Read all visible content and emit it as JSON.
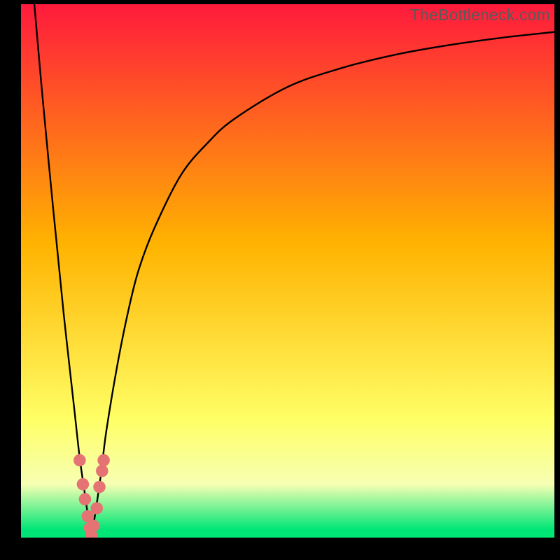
{
  "watermark": "TheBottleneck.com",
  "colors": {
    "gradient_top": "#ff1a3c",
    "gradient_mid": "#ffb300",
    "gradient_low": "#ffff66",
    "gradient_band": "#f6ffb3",
    "gradient_bottom": "#00e676",
    "curve": "#000000",
    "dot": "#e57373",
    "frame": "#000000"
  },
  "chart_data": {
    "type": "line",
    "title": "",
    "xlabel": "",
    "ylabel": "",
    "xlim": [
      0,
      100
    ],
    "ylim": [
      0,
      100
    ],
    "grid": false,
    "series": [
      {
        "name": "bottleneck-curve-left",
        "x": [
          2.5,
          4,
          6,
          8,
          10,
          11,
          12,
          12.7,
          13.2
        ],
        "values": [
          100,
          83,
          62,
          42,
          24,
          15,
          8,
          3,
          0
        ]
      },
      {
        "name": "bottleneck-curve-right",
        "x": [
          13.2,
          14,
          15,
          16,
          18,
          20,
          22,
          25,
          30,
          35,
          40,
          50,
          60,
          70,
          80,
          90,
          100
        ],
        "values": [
          0,
          5,
          12,
          20,
          32,
          42,
          50,
          58,
          68,
          74,
          78.5,
          84.5,
          88,
          90.5,
          92.3,
          93.7,
          94.8
        ]
      }
    ],
    "points": {
      "name": "sample-dots",
      "x": [
        11.0,
        11.6,
        12.0,
        12.5,
        12.9,
        13.2,
        13.6,
        14.2,
        14.7,
        15.2,
        15.5
      ],
      "y": [
        14.5,
        10.0,
        7.2,
        4.0,
        1.8,
        0.4,
        2.2,
        5.5,
        9.5,
        12.5,
        14.5
      ]
    },
    "gradient_stops": [
      {
        "pos": 0.0,
        "color_key": "gradient_top"
      },
      {
        "pos": 0.45,
        "color_key": "gradient_mid"
      },
      {
        "pos": 0.78,
        "color_key": "gradient_low"
      },
      {
        "pos": 0.9,
        "color_key": "gradient_band"
      },
      {
        "pos": 0.985,
        "color_key": "gradient_bottom"
      },
      {
        "pos": 1.0,
        "color_key": "gradient_bottom"
      }
    ]
  }
}
